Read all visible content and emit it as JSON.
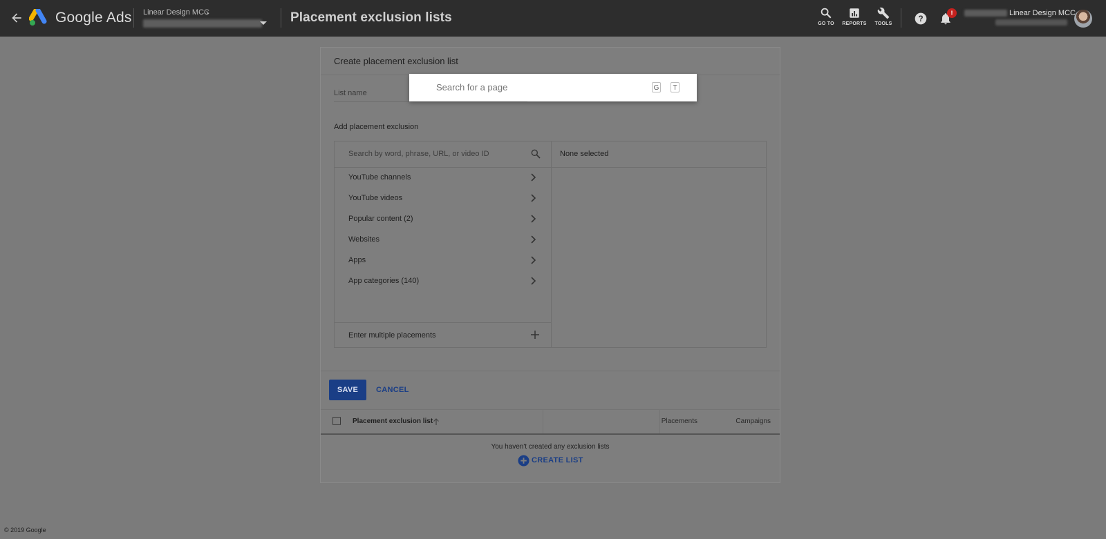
{
  "header": {
    "brand": "Google Ads",
    "account_name": "Linear Design MCC",
    "page_title": "Placement exclusion lists",
    "tools": [
      {
        "label": "GO TO",
        "icon": "search-icon"
      },
      {
        "label": "REPORTS",
        "icon": "reports-icon"
      },
      {
        "label": "TOOLS",
        "icon": "wrench-icon"
      }
    ],
    "notification_badge": "!",
    "user_account_name": "Linear Design MCC"
  },
  "form": {
    "title": "Create placement exclusion list",
    "list_name_label": "List name",
    "add_label": "Add placement exclusion",
    "search_placeholder": "Search by word, phrase, URL, or video ID",
    "categories": [
      "YouTube channels",
      "YouTube videos",
      "Popular content (2)",
      "Websites",
      "Apps",
      "App categories (140)"
    ],
    "enter_multiple": "Enter multiple placements",
    "selected_status": "None selected",
    "save_label": "SAVE",
    "cancel_label": "CANCEL"
  },
  "table": {
    "columns": [
      "Placement exclusion list",
      "Placements",
      "Campaigns"
    ],
    "empty_message": "You haven't created any exclusion lists",
    "create_label": "CREATE LIST"
  },
  "search_popup": {
    "placeholder": "Search for a page",
    "shortcuts": [
      "G",
      "T"
    ]
  },
  "footer": {
    "copyright": "© 2019 Google"
  },
  "colors": {
    "topbar": "#2d2d2d",
    "scrim": "#7b7b7b",
    "accent_blue": "#1a3e86",
    "badge_red": "#c5221f"
  }
}
